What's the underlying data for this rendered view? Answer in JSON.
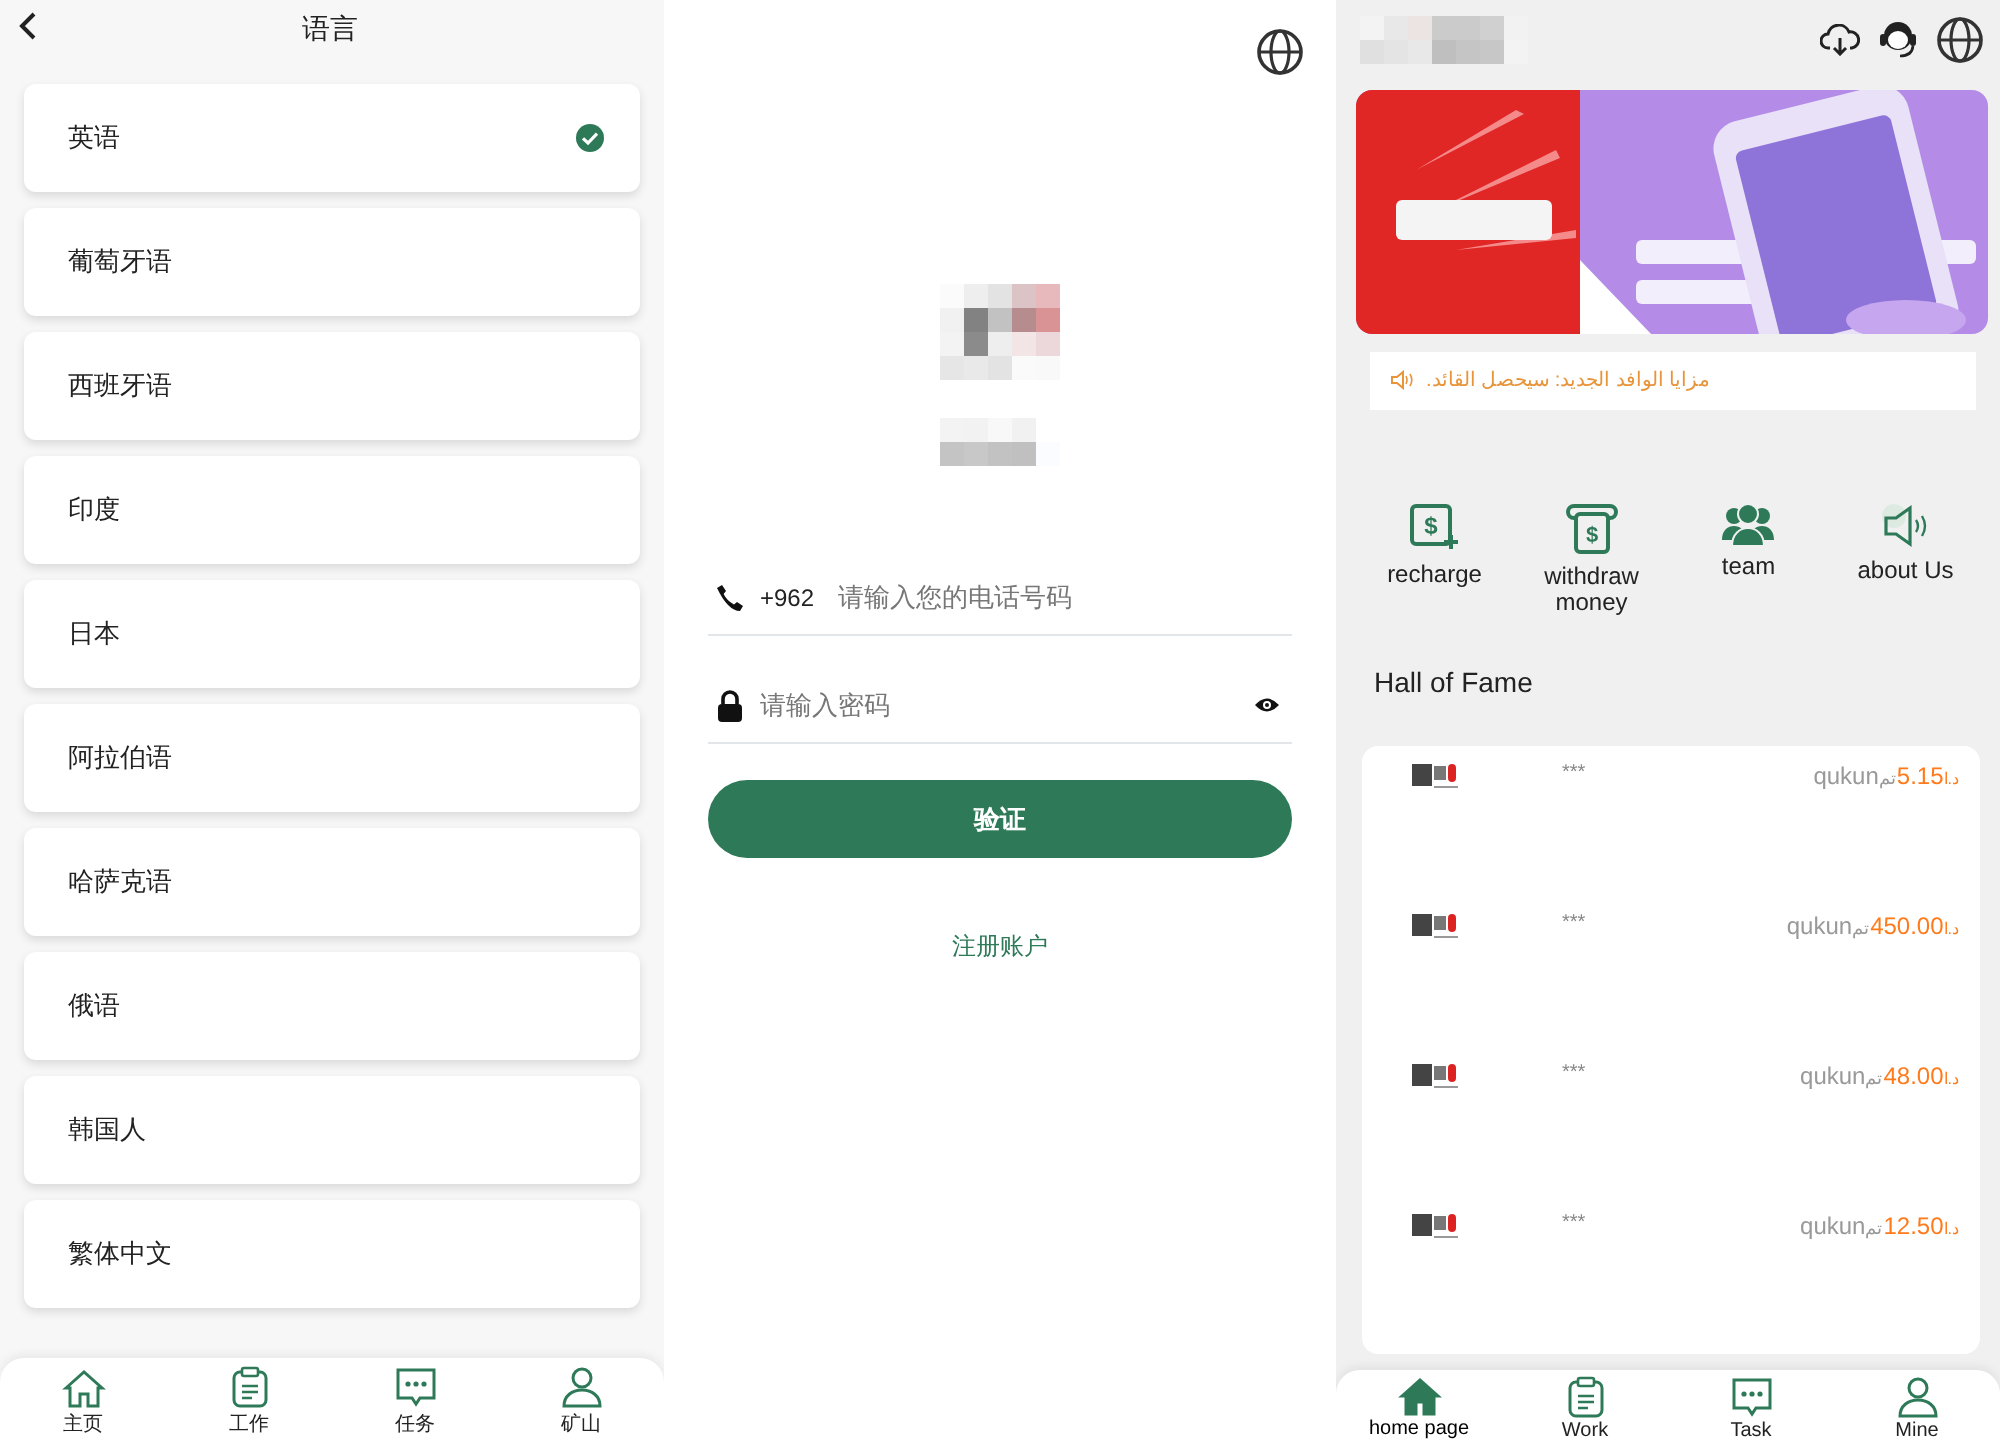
{
  "language_screen": {
    "title": "语言",
    "languages": [
      {
        "label": "英语",
        "selected": true
      },
      {
        "label": "葡萄牙语",
        "selected": false
      },
      {
        "label": "西班牙语",
        "selected": false
      },
      {
        "label": "印度",
        "selected": false
      },
      {
        "label": "日本",
        "selected": false
      },
      {
        "label": "阿拉伯语",
        "selected": false
      },
      {
        "label": "哈萨克语",
        "selected": false
      },
      {
        "label": "俄语",
        "selected": false
      },
      {
        "label": "韩国人",
        "selected": false
      },
      {
        "label": "繁体中文",
        "selected": false
      }
    ],
    "tab_bar": [
      {
        "label": "主页",
        "kind": "home",
        "selected": false
      },
      {
        "label": "工作",
        "kind": "work",
        "selected": false
      },
      {
        "label": "任务",
        "kind": "task",
        "selected": false
      },
      {
        "label": "矿山",
        "kind": "mine",
        "selected": false
      }
    ]
  },
  "login_screen": {
    "country_code": "+962",
    "phone": {
      "placeholder": "请输入您的电话号码"
    },
    "password": {
      "placeholder": "请输入密码"
    },
    "submit": "验证",
    "register_link": "注册账户"
  },
  "home_screen": {
    "notice": "مزايا الوافد الجديد: سيحصل القائد.",
    "actions": [
      {
        "label": "recharge",
        "kind": "recharge",
        "icon_glyph": "$"
      },
      {
        "label": "withdraw money",
        "kind": "withdraw",
        "icon_glyph": "$"
      },
      {
        "label": "team",
        "kind": "team"
      },
      {
        "label": "about Us",
        "kind": "about"
      }
    ],
    "hall_of_fame": {
      "title": "Hall of Fame",
      "rows": [
        {
          "masked": "***",
          "name": "qukun",
          "suffix": "تم",
          "amount": "5.15",
          "currency": "د.ا"
        },
        {
          "masked": "***",
          "name": "qukun",
          "suffix": "تم",
          "amount": "450.00",
          "currency": "د.ا"
        },
        {
          "masked": "***",
          "name": "qukun",
          "suffix": "تم",
          "amount": "48.00",
          "currency": "د.ا"
        },
        {
          "masked": "***",
          "name": "qukun",
          "suffix": "تم",
          "amount": "12.50",
          "currency": "د.ا"
        }
      ]
    },
    "tab_bar": [
      {
        "label": "home page",
        "kind": "home",
        "selected": true
      },
      {
        "label": "Work",
        "kind": "work",
        "selected": false
      },
      {
        "label": "Task",
        "kind": "task",
        "selected": false
      },
      {
        "label": "Mine",
        "kind": "mine",
        "selected": false
      }
    ]
  }
}
